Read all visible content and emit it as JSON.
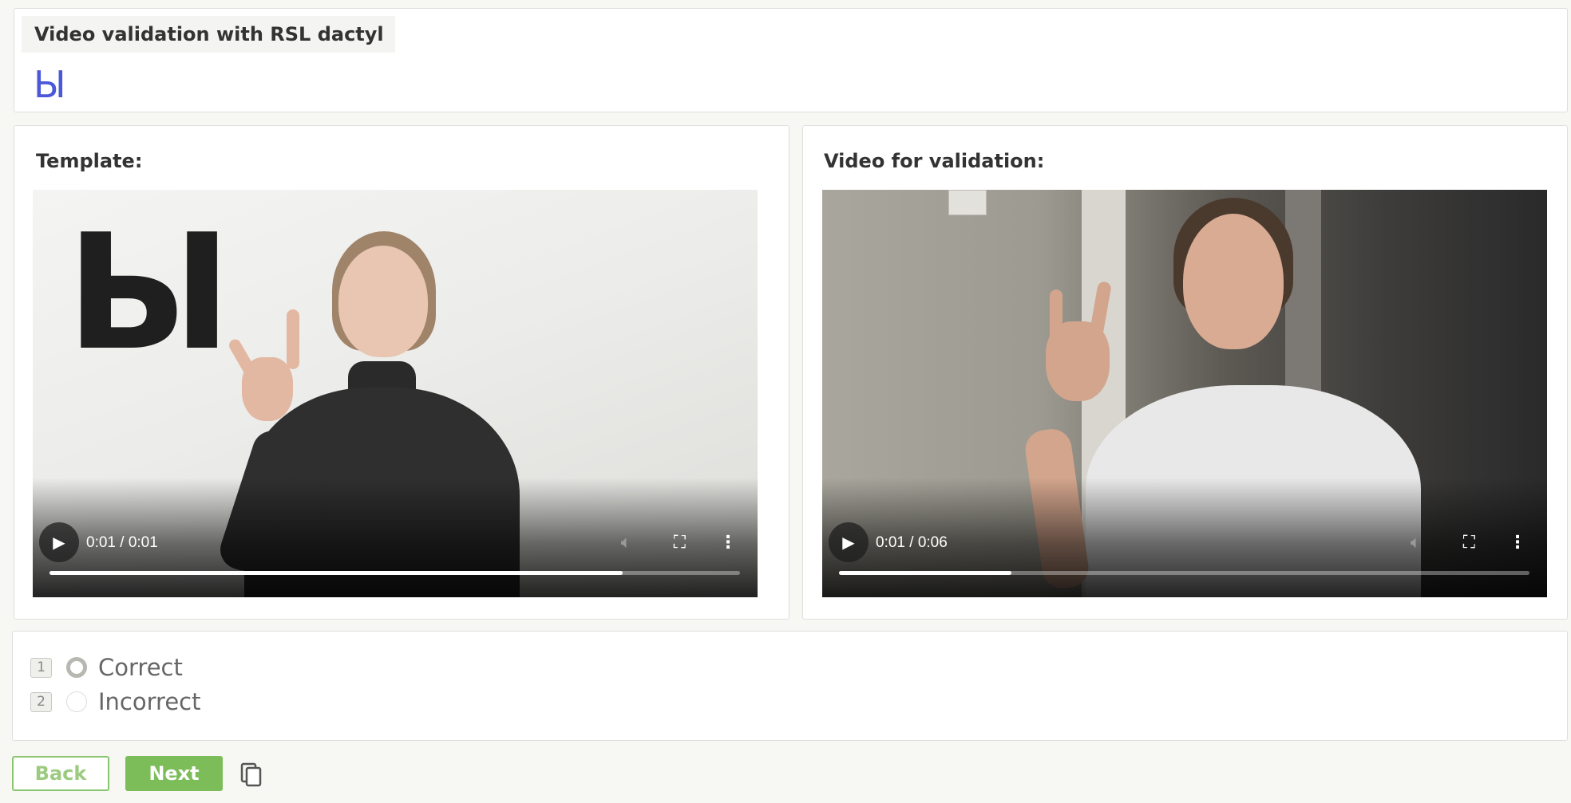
{
  "header": {
    "title": "Video validation with RSL dactyl",
    "letter": "Ы"
  },
  "template_panel": {
    "label": "Template:",
    "video": {
      "overlay_letter": "Ы",
      "time": "0:01 / 0:01",
      "progress": 0.83
    }
  },
  "validation_panel": {
    "label": "Video for validation:",
    "video": {
      "time": "0:01 / 0:06",
      "progress": 0.25
    }
  },
  "options": [
    {
      "number": "1",
      "label": "Correct",
      "selected": true
    },
    {
      "number": "2",
      "label": "Incorrect",
      "selected": false
    }
  ],
  "footer": {
    "back_label": "Back",
    "next_label": "Next",
    "copy_icon": "copy-icon"
  },
  "icons": {
    "play": "play-icon",
    "volume": "volume-icon",
    "fullscreen": "fullscreen-icon",
    "more": "more-vertical-icon"
  },
  "colors": {
    "accent_green": "#7cbd5a",
    "letter_blue": "#4d58d9"
  }
}
